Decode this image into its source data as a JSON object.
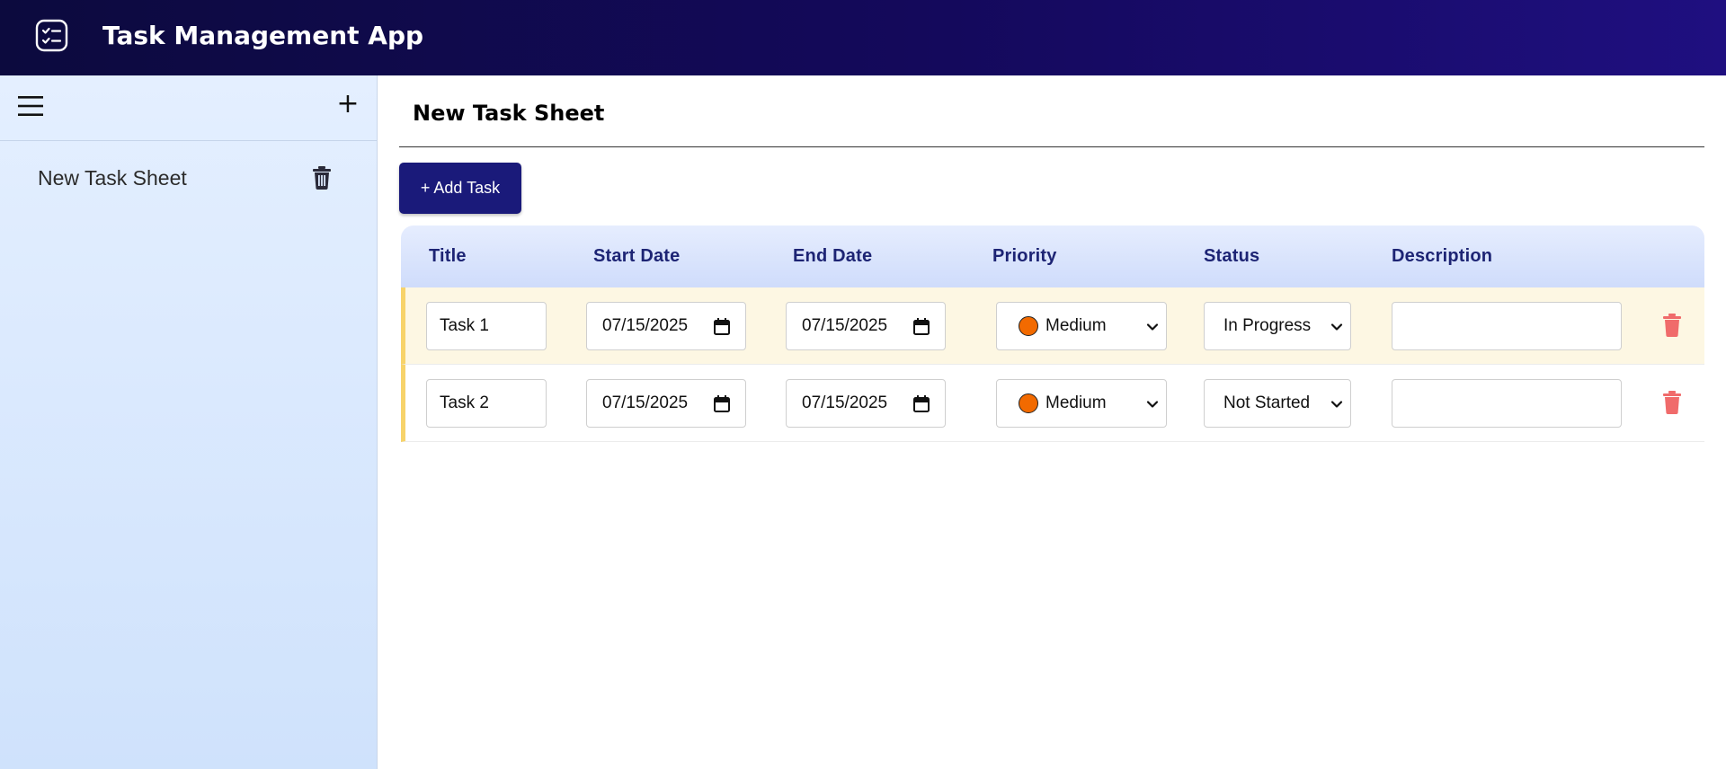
{
  "app": {
    "title": "Task Management App",
    "logo_icon": "checklist-icon"
  },
  "sidebar": {
    "menu_icon": "hamburger-menu-icon",
    "add_label": "+",
    "sheets": [
      {
        "label": "New Task Sheet",
        "delete_icon": "trash-icon"
      }
    ]
  },
  "main": {
    "title": "New Task Sheet",
    "add_task_label": "+ Add Task",
    "columns": [
      "Title",
      "Start Date",
      "End Date",
      "Priority",
      "Status",
      "Description"
    ],
    "tasks": [
      {
        "title": "Task 1",
        "start_date": "07/15/2025",
        "end_date": "07/15/2025",
        "priority": "Medium",
        "status": "In Progress",
        "description": ""
      },
      {
        "title": "Task 2",
        "start_date": "07/15/2025",
        "end_date": "07/15/2025",
        "priority": "Medium",
        "status": "Not Started",
        "description": ""
      }
    ]
  },
  "colors": {
    "accent": "#1a1a7a",
    "priority_medium": "#f26a00",
    "row_marker": "#f7d36a",
    "delete_red": "#f06b6b"
  }
}
